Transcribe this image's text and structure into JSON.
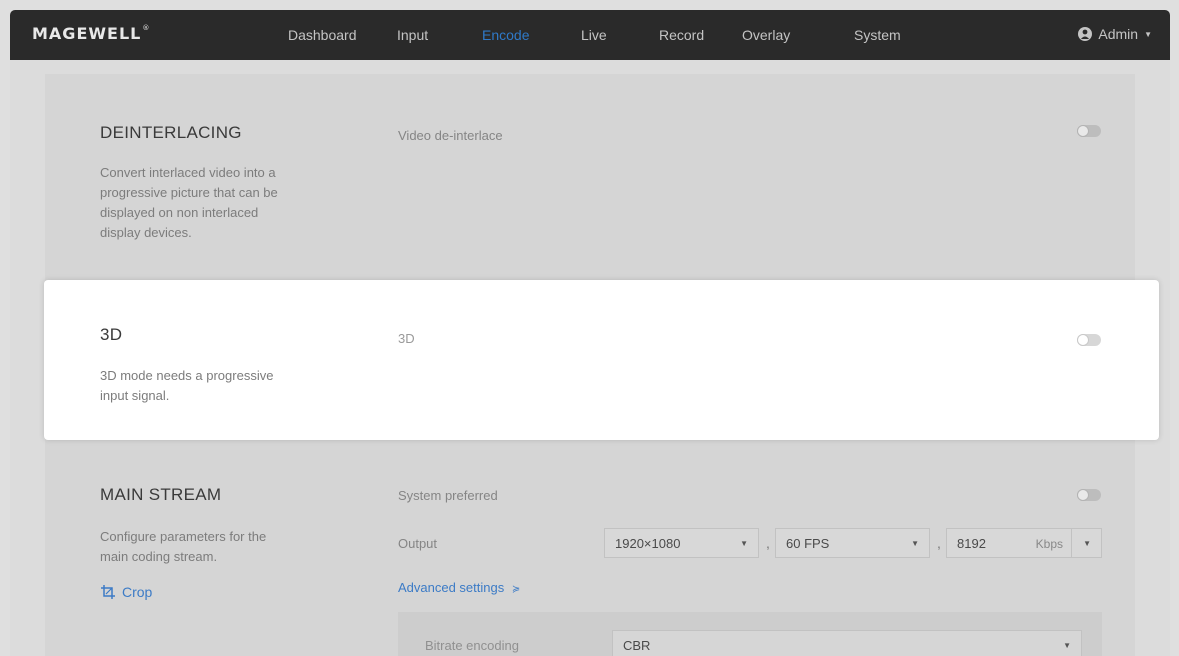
{
  "header": {
    "logo": "MAGEWELL",
    "logo_mark": "®",
    "nav": [
      "Dashboard",
      "Input",
      "Encode",
      "Live",
      "Record",
      "Overlay",
      "System"
    ],
    "active_nav": "Encode",
    "user": "Admin"
  },
  "deinterlacing": {
    "title": "DEINTERLACING",
    "desc_lines": [
      "Convert interlaced video into a",
      "progressive picture that can be",
      "displayed on non interlaced",
      "display devices."
    ],
    "field_label": "Video de-interlace",
    "enabled": false
  },
  "three_d": {
    "title": "3D",
    "desc_lines": [
      "3D mode needs a progressive",
      "input signal."
    ],
    "field_label": "3D",
    "enabled": false
  },
  "main_stream": {
    "title": "MAIN STREAM",
    "desc_lines": [
      "Configure parameters for the",
      "main coding stream."
    ],
    "crop_label": "Crop",
    "system_preferred_label": "System preferred",
    "system_preferred_enabled": false,
    "output_label": "Output",
    "resolution": "1920×1080",
    "fps": "60 FPS",
    "bitrate": "8192",
    "bitrate_unit": "Kbps",
    "separator": ",",
    "advanced_label": "Advanced settings",
    "advanced_icon": "double-chevron-down-icon",
    "bitrate_encoding_label": "Bitrate encoding",
    "bitrate_encoding_value": "CBR"
  },
  "colors": {
    "nav_bg": "#2a2a2a",
    "accent": "#2f79c8",
    "link": "#3c7bc6"
  }
}
